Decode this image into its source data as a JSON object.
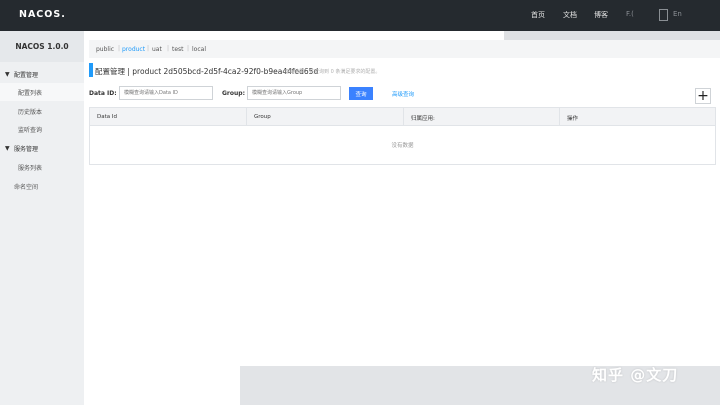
{
  "header": {
    "logo": "NACOS.",
    "nav": [
      "首页",
      "文档",
      "博客"
    ],
    "extra": "F.(",
    "lang_text": "En"
  },
  "sidebar": {
    "title": "NACOS 1.0.0",
    "config_group": "配置管理",
    "config_items": [
      "配置列表",
      "历史版本",
      "监听查询"
    ],
    "service_group": "服务管理",
    "service_items": [
      "服务列表"
    ],
    "namespace": "命名空间"
  },
  "namespaces": [
    "public",
    "product",
    "uat",
    "test",
    "local"
  ],
  "page": {
    "title": "配置管理 | product 2d505bcd-2d5f-4ca2-92f0-b9ea44fed65d",
    "hint": "查询结果：共查询到 0 条满足要求的配置。"
  },
  "filters": {
    "data_id_label": "Data ID:",
    "data_id_placeholder": "模糊查询请输入Data ID",
    "group_label": "Group:",
    "group_placeholder": "模糊查询请输入Group",
    "search_button": "查询",
    "advanced_link": "高级查询",
    "add_symbol": "+"
  },
  "table": {
    "columns": [
      "Data Id",
      "Group",
      "归属应用:",
      "操作"
    ],
    "empty_text": "没有数据"
  },
  "watermark": "知乎 @文刀",
  "colors": {
    "accent": "#209bfa",
    "button": "#3b82ff",
    "topbar": "#252a2f",
    "sidebar": "#eef0f2"
  }
}
